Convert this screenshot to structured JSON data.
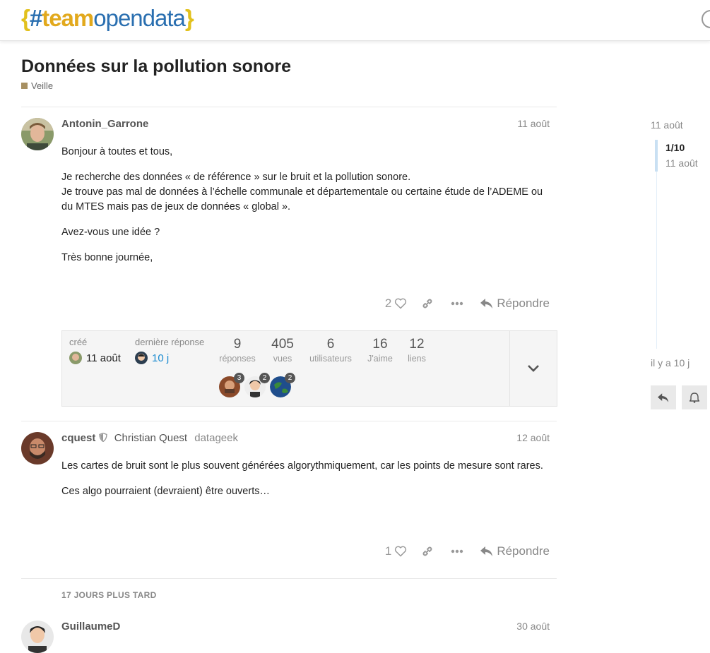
{
  "header": {
    "logo_brace_open": "{",
    "logo_hash": "#",
    "logo_team": "team",
    "logo_opendata": "opendata",
    "logo_brace_close": "}"
  },
  "topic": {
    "title": "Données sur la pollution sonore",
    "category": "Veille",
    "category_color": "#a79062"
  },
  "posts": [
    {
      "username": "Antonin_Garrone",
      "date": "11 août",
      "paragraphs": [
        "Bonjour à toutes et tous,",
        "Je recherche des données « de référence » sur le bruit et la pollution sonore.",
        "Je trouve pas mal de données à l’échelle communale et départementale ou certaine étude de l’ADEME ou du MTES mais pas de jeux de données « global ».",
        "Avez-vous une idée ?",
        "Très bonne journée,"
      ],
      "likes": "2",
      "reply_label": "Répondre"
    },
    {
      "username": "cquest",
      "full_name": "Christian Quest",
      "user_title": "datageek",
      "date": "12 août",
      "paragraphs": [
        "Les cartes de bruit sont le plus souvent générées algorythmiquement, car les points de mesure sont rares.",
        "Ces algo pourraient (devraient) être ouverts…"
      ],
      "likes": "1",
      "reply_label": "Répondre"
    },
    {
      "username": "GuillaumeD",
      "date": "30 août"
    }
  ],
  "summary": {
    "created_label": "créé",
    "created_value": "11 août",
    "last_reply_label": "dernière réponse",
    "last_reply_value": "10 j",
    "stats": [
      {
        "value": "9",
        "label": "réponses"
      },
      {
        "value": "405",
        "label": "vues"
      },
      {
        "value": "6",
        "label": "utilisateurs"
      },
      {
        "value": "16",
        "label": "J'aime"
      },
      {
        "value": "12",
        "label": "liens"
      }
    ],
    "participants": [
      {
        "count": "3"
      },
      {
        "count": "2"
      },
      {
        "count": "2"
      }
    ]
  },
  "gap_label": "17 JOURS PLUS TARD",
  "timeline": {
    "start_date": "11 août",
    "position": "1/10",
    "position_date": "11 août",
    "end_label": "il y a 10 j"
  },
  "colors": {
    "accent_link": "#1a8bd0",
    "muted": "#888888"
  }
}
